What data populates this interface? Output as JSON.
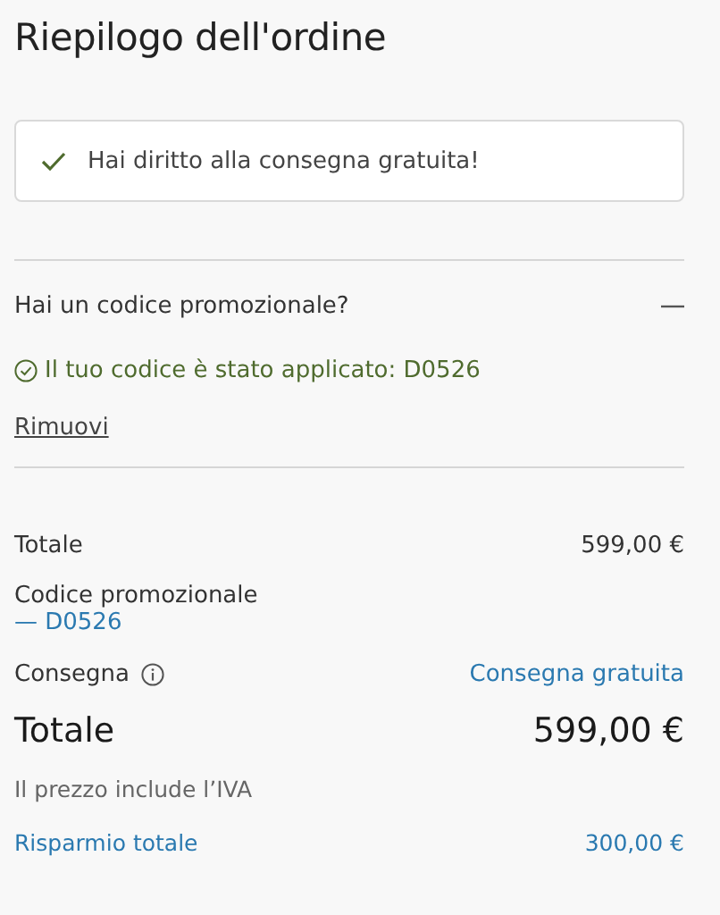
{
  "title": "Riepilogo dell'ordine",
  "notice": {
    "text": "Hai diritto alla consegna gratuita!"
  },
  "promo": {
    "label": "Hai un codice promozionale?",
    "expanded": true,
    "applied": "Il tuo codice è stato applicato: D0526",
    "remove_link": "Rimuovi"
  },
  "summary": [
    {
      "kind": "line",
      "label": "Totale",
      "value": "599,00 €"
    },
    {
      "kind": "code",
      "label": "Codice promozionale",
      "code": "— D0526"
    },
    {
      "kind": "info",
      "label": "Consegna",
      "value": "Consegna gratuita"
    },
    {
      "kind": "total",
      "label": "Totale",
      "value": "599,00 €"
    },
    {
      "kind": "note",
      "label": "Il prezzo include l’IVA"
    },
    {
      "kind": "savings",
      "label": "Risparmio totale",
      "value": "300,00 €"
    }
  ]
}
